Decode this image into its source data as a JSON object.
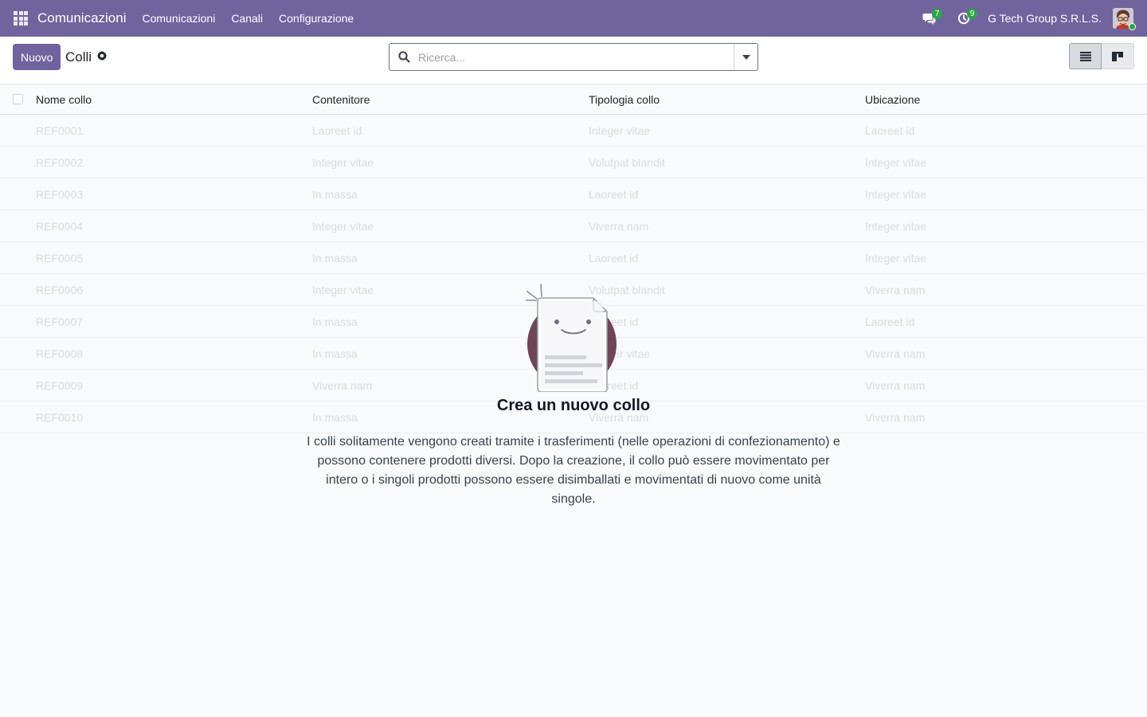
{
  "navbar": {
    "app_name": "Comunicazioni",
    "menu": [
      "Comunicazioni",
      "Canali",
      "Configurazione"
    ],
    "messages_count": "7",
    "activities_count": "9",
    "company": "G Tech Group S.R.L.S.",
    "bg_color": "#71639e"
  },
  "control": {
    "new_label": "Nuovo",
    "title": "Colli",
    "search_placeholder": "Ricerca..."
  },
  "list": {
    "columns": [
      "Nome collo",
      "Contenitore",
      "Tipologia collo",
      "Ubicazione"
    ],
    "rows": [
      [
        "REF0001",
        "Laoreet id",
        "Integer vitae",
        "Laoreet id"
      ],
      [
        "REF0002",
        "Integer vitae",
        "Volutpat blandit",
        "Integer vitae"
      ],
      [
        "REF0003",
        "In massa",
        "Laoreet id",
        "Integer vitae"
      ],
      [
        "REF0004",
        "Integer vitae",
        "Viverra nam",
        "Integer vitae"
      ],
      [
        "REF0005",
        "In massa",
        "Laoreet id",
        "Integer vitae"
      ],
      [
        "REF0006",
        "Integer vitae",
        "Volutpat blandit",
        "Viverra nam"
      ],
      [
        "REF0007",
        "In massa",
        "Laoreet id",
        "Laoreet id"
      ],
      [
        "REF0008",
        "In massa",
        "Integer vitae",
        "Viverra nam"
      ],
      [
        "REF0009",
        "Viverra nam",
        "Laoreet id",
        "Viverra nam"
      ],
      [
        "REF0010",
        "In massa",
        "Viverra nam",
        "Viverra nam"
      ]
    ]
  },
  "helper": {
    "title": "Crea un nuovo collo",
    "text": "I colli solitamente vengono creati tramite i trasferimenti (nelle operazioni di confezionamento) e possono contenere prodotti diversi. Dopo la creazione, il collo può essere movimentato per intero o i singoli prodotti possono essere disimballati e movimentati di nuovo come unità singole."
  }
}
